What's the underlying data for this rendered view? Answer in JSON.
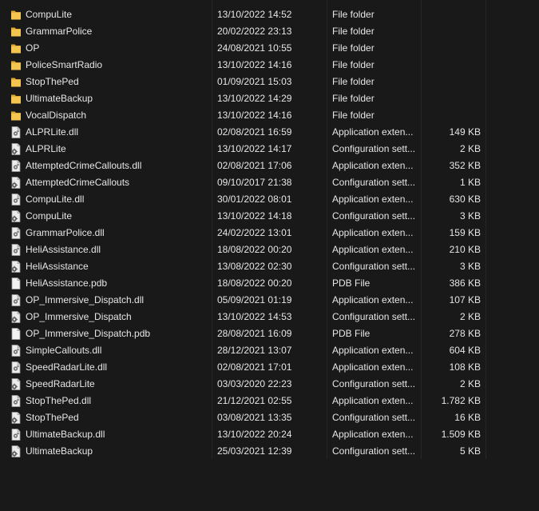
{
  "files": [
    {
      "icon": "folder-icon",
      "name": "CompuLite",
      "date": "13/10/2022 14:52",
      "type": "File folder",
      "size": ""
    },
    {
      "icon": "folder-icon",
      "name": "GrammarPolice",
      "date": "20/02/2022 23:13",
      "type": "File folder",
      "size": ""
    },
    {
      "icon": "folder-icon",
      "name": "OP",
      "date": "24/08/2021 10:55",
      "type": "File folder",
      "size": ""
    },
    {
      "icon": "folder-icon",
      "name": "PoliceSmartRadio",
      "date": "13/10/2022 14:16",
      "type": "File folder",
      "size": ""
    },
    {
      "icon": "folder-icon",
      "name": "StopThePed",
      "date": "01/09/2021 15:03",
      "type": "File folder",
      "size": ""
    },
    {
      "icon": "folder-icon",
      "name": "UltimateBackup",
      "date": "13/10/2022 14:29",
      "type": "File folder",
      "size": ""
    },
    {
      "icon": "folder-icon",
      "name": "VocalDispatch",
      "date": "13/10/2022 14:16",
      "type": "File folder",
      "size": ""
    },
    {
      "icon": "dll-icon",
      "name": "ALPRLite.dll",
      "date": "02/08/2021 16:59",
      "type": "Application exten...",
      "size": "149 KB"
    },
    {
      "icon": "config-icon",
      "name": "ALPRLite",
      "date": "13/10/2022 14:17",
      "type": "Configuration sett...",
      "size": "2 KB"
    },
    {
      "icon": "dll-icon",
      "name": "AttemptedCrimeCallouts.dll",
      "date": "02/08/2021 17:06",
      "type": "Application exten...",
      "size": "352 KB"
    },
    {
      "icon": "config-icon",
      "name": "AttemptedCrimeCallouts",
      "date": "09/10/2017 21:38",
      "type": "Configuration sett...",
      "size": "1 KB"
    },
    {
      "icon": "dll-icon",
      "name": "CompuLite.dll",
      "date": "30/01/2022 08:01",
      "type": "Application exten...",
      "size": "630 KB"
    },
    {
      "icon": "config-icon",
      "name": "CompuLite",
      "date": "13/10/2022 14:18",
      "type": "Configuration sett...",
      "size": "3 KB"
    },
    {
      "icon": "dll-icon",
      "name": "GrammarPolice.dll",
      "date": "24/02/2022 13:01",
      "type": "Application exten...",
      "size": "159 KB"
    },
    {
      "icon": "dll-icon",
      "name": "HeliAssistance.dll",
      "date": "18/08/2022 00:20",
      "type": "Application exten...",
      "size": "210 KB"
    },
    {
      "icon": "config-icon",
      "name": "HeliAssistance",
      "date": "13/08/2022 02:30",
      "type": "Configuration sett...",
      "size": "3 KB"
    },
    {
      "icon": "pdb-file-icon",
      "name": "HeliAssistance.pdb",
      "date": "18/08/2022 00:20",
      "type": "PDB File",
      "size": "386 KB"
    },
    {
      "icon": "dll-icon",
      "name": "OP_Immersive_Dispatch.dll",
      "date": "05/09/2021 01:19",
      "type": "Application exten...",
      "size": "107 KB"
    },
    {
      "icon": "config-icon",
      "name": "OP_Immersive_Dispatch",
      "date": "13/10/2022 14:53",
      "type": "Configuration sett...",
      "size": "2 KB"
    },
    {
      "icon": "pdb-file-icon",
      "name": "OP_Immersive_Dispatch.pdb",
      "date": "28/08/2021 16:09",
      "type": "PDB File",
      "size": "278 KB"
    },
    {
      "icon": "dll-icon",
      "name": "SimpleCallouts.dll",
      "date": "28/12/2021 13:07",
      "type": "Application exten...",
      "size": "604 KB"
    },
    {
      "icon": "dll-icon",
      "name": "SpeedRadarLite.dll",
      "date": "02/08/2021 17:01",
      "type": "Application exten...",
      "size": "108 KB"
    },
    {
      "icon": "config-icon",
      "name": "SpeedRadarLite",
      "date": "03/03/2020 22:23",
      "type": "Configuration sett...",
      "size": "2 KB"
    },
    {
      "icon": "dll-icon",
      "name": "StopThePed.dll",
      "date": "21/12/2021 02:55",
      "type": "Application exten...",
      "size": "1.782 KB"
    },
    {
      "icon": "config-icon",
      "name": "StopThePed",
      "date": "03/08/2021 13:35",
      "type": "Configuration sett...",
      "size": "16 KB"
    },
    {
      "icon": "dll-icon",
      "name": "UltimateBackup.dll",
      "date": "13/10/2022 20:24",
      "type": "Application exten...",
      "size": "1.509 KB"
    },
    {
      "icon": "config-icon",
      "name": "UltimateBackup",
      "date": "25/03/2021 12:39",
      "type": "Configuration sett...",
      "size": "5 KB"
    }
  ],
  "colors": {
    "background": "#191919",
    "text": "#e6e6e6",
    "folder": "#f4c64f",
    "file_page": "#e8e8e8"
  }
}
